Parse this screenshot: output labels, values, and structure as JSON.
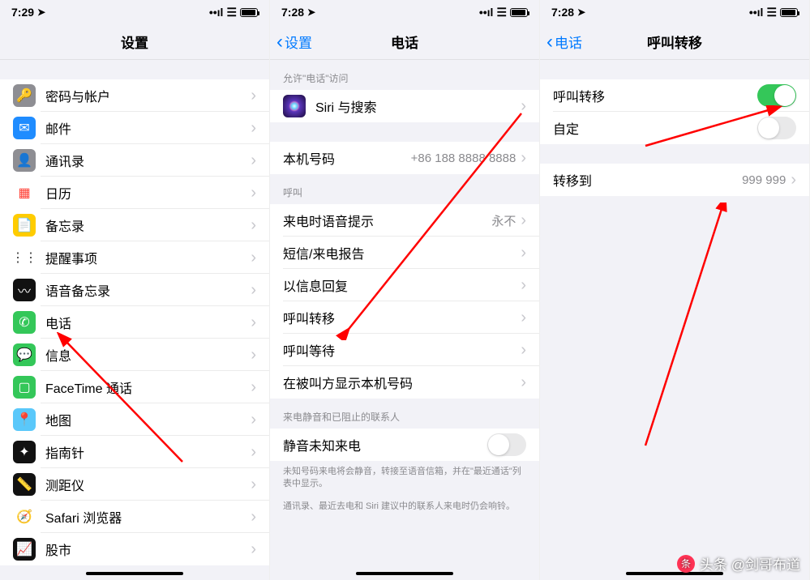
{
  "status": {
    "time1": "7:29",
    "time2": "7:28",
    "time3": "7:28"
  },
  "pane1": {
    "title": "设置",
    "items": [
      {
        "name": "passwords",
        "label": "密码与帐户",
        "icon": "🔑",
        "bg": "#8e8e93"
      },
      {
        "name": "mail",
        "label": "邮件",
        "icon": "✉︎",
        "bg": "#1f8cff"
      },
      {
        "name": "contacts",
        "label": "通讯录",
        "icon": "👤",
        "bg": "#8e8e93"
      },
      {
        "name": "calendar",
        "label": "日历",
        "icon": "▦",
        "bg": "#ffffff",
        "fg": "#ff3b30"
      },
      {
        "name": "notes",
        "label": "备忘录",
        "icon": "📄",
        "bg": "#ffcc00"
      },
      {
        "name": "reminders",
        "label": "提醒事项",
        "icon": "⋮⋮",
        "bg": "#ffffff",
        "fg": "#333"
      },
      {
        "name": "voicememos",
        "label": "语音备忘录",
        "icon": "〰",
        "bg": "#111"
      },
      {
        "name": "phone",
        "label": "电话",
        "icon": "✆",
        "bg": "#34c759"
      },
      {
        "name": "messages",
        "label": "信息",
        "icon": "💬",
        "bg": "#34c759"
      },
      {
        "name": "facetime",
        "label": "FaceTime 通话",
        "icon": "▢",
        "bg": "#34c759"
      },
      {
        "name": "maps",
        "label": "地图",
        "icon": "📍",
        "bg": "#5ac8fa"
      },
      {
        "name": "compass",
        "label": "指南针",
        "icon": "✦",
        "bg": "#111"
      },
      {
        "name": "measure",
        "label": "测距仪",
        "icon": "📏",
        "bg": "#111"
      },
      {
        "name": "safari",
        "label": "Safari 浏览器",
        "icon": "🧭",
        "bg": "#ffffff",
        "fg": "#007aff"
      },
      {
        "name": "stocks",
        "label": "股市",
        "icon": "📈",
        "bg": "#111"
      }
    ]
  },
  "pane2": {
    "back": "设置",
    "title": "电话",
    "section_allow": "允许\"电话\"访问",
    "siri_label": "Siri 与搜索",
    "my_number_label": "本机号码",
    "my_number_value": "+86 188 8888 8888",
    "section_calls": "呼叫",
    "rows": [
      {
        "name": "announce",
        "label": "来电时语音提示",
        "value": "永不"
      },
      {
        "name": "sms-report",
        "label": "短信/来电报告",
        "value": ""
      },
      {
        "name": "msg-reply",
        "label": "以信息回复",
        "value": ""
      },
      {
        "name": "call-forward",
        "label": "呼叫转移",
        "value": ""
      },
      {
        "name": "call-waiting",
        "label": "呼叫等待",
        "value": ""
      },
      {
        "name": "show-id",
        "label": "在被叫方显示本机号码",
        "value": ""
      }
    ],
    "section_silence": "来电静音和已阻止的联系人",
    "silence_label": "静音未知来电",
    "footer1": "未知号码来电将会静音，转接至语音信箱，并在\"最近通话\"列表中显示。",
    "footer2": "通讯录、最近去电和 Siri 建议中的联系人来电时仍会响铃。"
  },
  "pane3": {
    "back": "电话",
    "title": "呼叫转移",
    "forward_label": "呼叫转移",
    "custom_label": "自定",
    "forward_to_label": "转移到",
    "forward_to_value": "999 999"
  },
  "watermark": "头条 @剑哥布道"
}
